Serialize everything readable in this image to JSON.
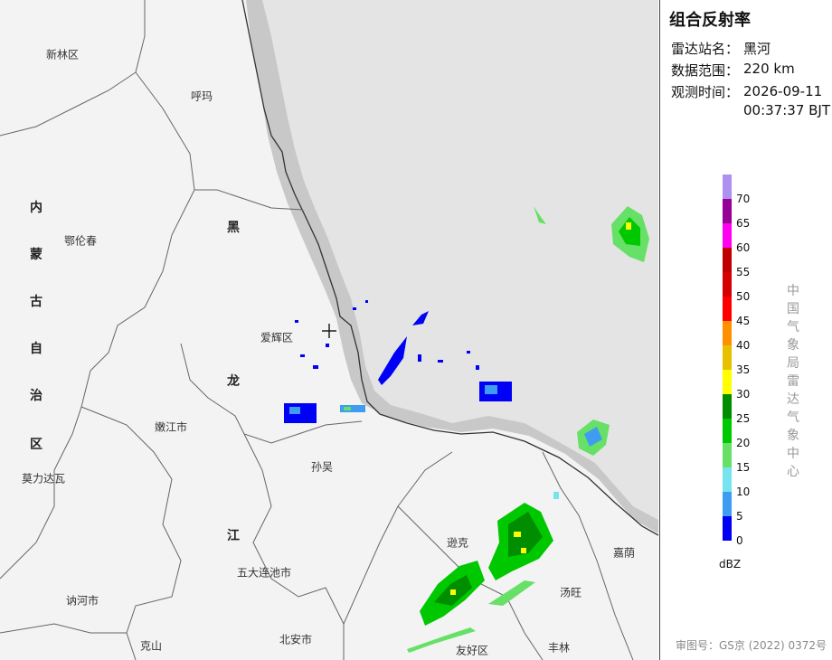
{
  "map": {
    "places": [
      {
        "id": "xinlinqu",
        "name": "新林区"
      },
      {
        "id": "huma",
        "name": "呼玛"
      },
      {
        "id": "elunchun",
        "name": "鄂伦春"
      },
      {
        "id": "aihuiqu",
        "name": "爱辉区"
      },
      {
        "id": "nenjiangshi",
        "name": "嫩江市"
      },
      {
        "id": "xunke_sunwu",
        "name": "孙吴"
      },
      {
        "id": "molidawa",
        "name": "莫力达瓦"
      },
      {
        "id": "xunke",
        "name": "逊克"
      },
      {
        "id": "jiayin",
        "name": "嘉荫"
      },
      {
        "id": "wudalianchi",
        "name": "五大连池市"
      },
      {
        "id": "tangwang",
        "name": "汤旺"
      },
      {
        "id": "neheshi",
        "name": "讷河市"
      },
      {
        "id": "beianshi",
        "name": "北安市"
      },
      {
        "id": "keshan",
        "name": "克山"
      },
      {
        "id": "youhaoqu",
        "name": "友好区"
      },
      {
        "id": "fenglin",
        "name": "丰林"
      }
    ],
    "provinces": [
      {
        "id": "nei",
        "name": "内"
      },
      {
        "id": "meng",
        "name": "蒙"
      },
      {
        "id": "gu",
        "name": "古"
      },
      {
        "id": "zi",
        "name": "自"
      },
      {
        "id": "zhi",
        "name": "治"
      },
      {
        "id": "qu",
        "name": "区"
      },
      {
        "id": "hei",
        "name": "黑"
      },
      {
        "id": "long",
        "name": "龙"
      },
      {
        "id": "jiang",
        "name": "江"
      }
    ],
    "colors": {
      "land": "#f3f3f3",
      "foreign": "#e4e4e4",
      "border_band": "#c8c8c8",
      "boundary": "#555555",
      "river": "#333333"
    }
  },
  "panel": {
    "title": "组合反射率",
    "station_label": "雷达站名：",
    "station_value": "黑河",
    "range_label": "数据范围：",
    "range_value": "220 km",
    "time_label": "观测时间：",
    "time_date": "2026-09-11",
    "time_clock": "00:37:37 BJT",
    "unit": "dBZ",
    "org_chars": [
      "中",
      "国",
      "气",
      "象",
      "局",
      "雷",
      "达",
      "气",
      "象",
      "中",
      "心"
    ],
    "approval": "审图号：GS京 (2022) 0372号"
  },
  "legend": {
    "levels": [
      {
        "label": "70",
        "color": "#ad90f0"
      },
      {
        "label": "65",
        "color": "#960096"
      },
      {
        "label": "60",
        "color": "#ff00f0"
      },
      {
        "label": "55",
        "color": "#c00000"
      },
      {
        "label": "50",
        "color": "#d60000"
      },
      {
        "label": "45",
        "color": "#ff0000"
      },
      {
        "label": "40",
        "color": "#ff9000"
      },
      {
        "label": "35",
        "color": "#e7c000"
      },
      {
        "label": "30",
        "color": "#ffff00"
      },
      {
        "label": "25",
        "color": "#008e00"
      },
      {
        "label": "20",
        "color": "#00c800"
      },
      {
        "label": "15",
        "color": "#66e066"
      },
      {
        "label": "10",
        "color": "#76e4ef"
      },
      {
        "label": "5",
        "color": "#3e9df0"
      },
      {
        "label": "0",
        "color": "#0000f6"
      }
    ]
  },
  "echoes": {
    "colors": {
      "weak": "#0000f6",
      "light": "#3e9df0",
      "cyan": "#76e4ef",
      "lightgreen": "#66e066",
      "green": "#00c800",
      "darkgreen": "#008e00",
      "yellow": "#ffff00"
    }
  }
}
